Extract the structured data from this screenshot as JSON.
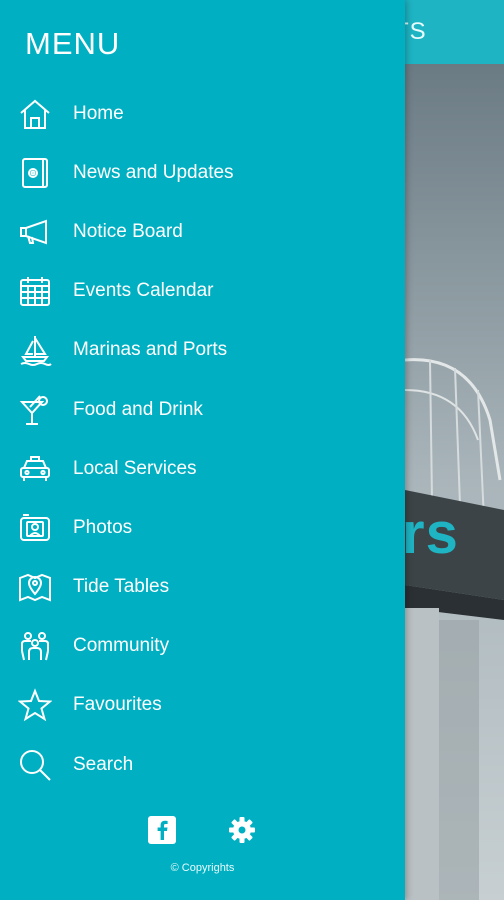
{
  "background": {
    "header_title": "TS",
    "hero_text": "rs"
  },
  "drawer": {
    "title": "MENU",
    "items": [
      {
        "label": "Home",
        "icon": "home-icon"
      },
      {
        "label": "News and Updates",
        "icon": "news-icon"
      },
      {
        "label": "Notice Board",
        "icon": "megaphone-icon"
      },
      {
        "label": "Events Calendar",
        "icon": "calendar-icon"
      },
      {
        "label": "Marinas and Ports",
        "icon": "sailboat-icon"
      },
      {
        "label": "Food and Drink",
        "icon": "cocktail-icon"
      },
      {
        "label": "Local Services",
        "icon": "taxi-icon"
      },
      {
        "label": "Photos",
        "icon": "photo-icon"
      },
      {
        "label": "Tide Tables",
        "icon": "map-pin-icon"
      },
      {
        "label": "Community",
        "icon": "community-icon"
      },
      {
        "label": "Favourites",
        "icon": "star-icon"
      },
      {
        "label": "Search",
        "icon": "search-icon"
      }
    ],
    "footer": {
      "copyright": "© Copyrights"
    }
  },
  "colors": {
    "drawer_bg": "#00b0c2",
    "accent": "#1eb4c4",
    "text": "#ffffff"
  }
}
